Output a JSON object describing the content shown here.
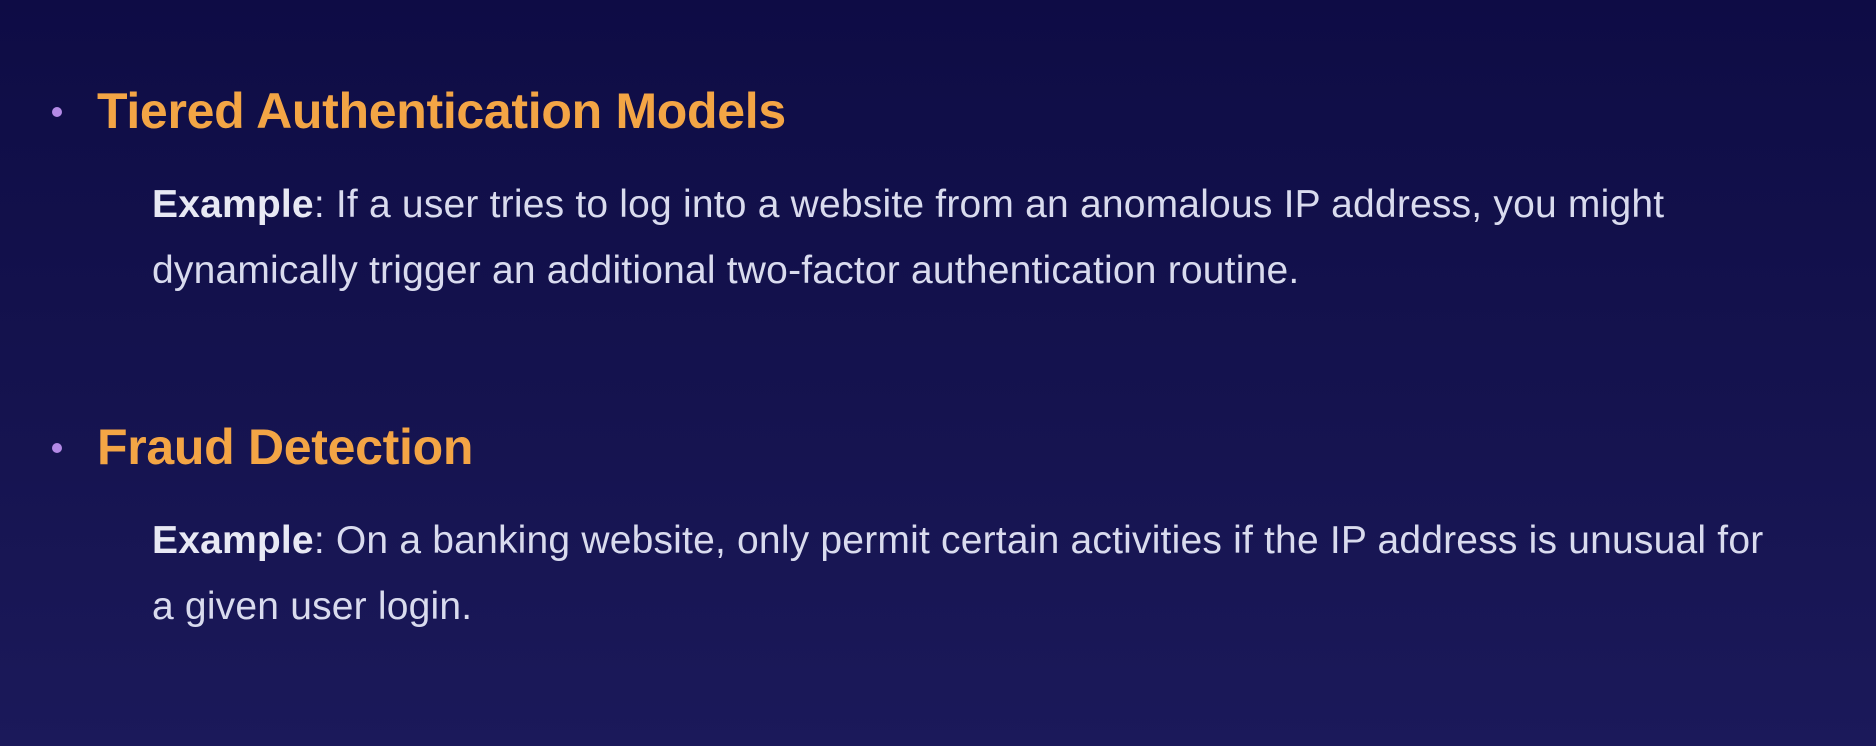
{
  "items": [
    {
      "heading": "Tiered Authentication Models",
      "example_label": "Example",
      "example_text": ": If a user tries to log into a website from an anomalous IP address, you might dynamically trigger an additional two-factor authentication routine."
    },
    {
      "heading": "Fraud Detection",
      "example_label": "Example",
      "example_text": ": On a banking website, only permit certain activities if the IP address is unusual for a given user login."
    }
  ],
  "colors": {
    "background_top": "#0e0c45",
    "background_bottom": "#1b195a",
    "heading": "#f3a545",
    "bullet": "#b48ae6",
    "body_text": "#d9dbee"
  }
}
